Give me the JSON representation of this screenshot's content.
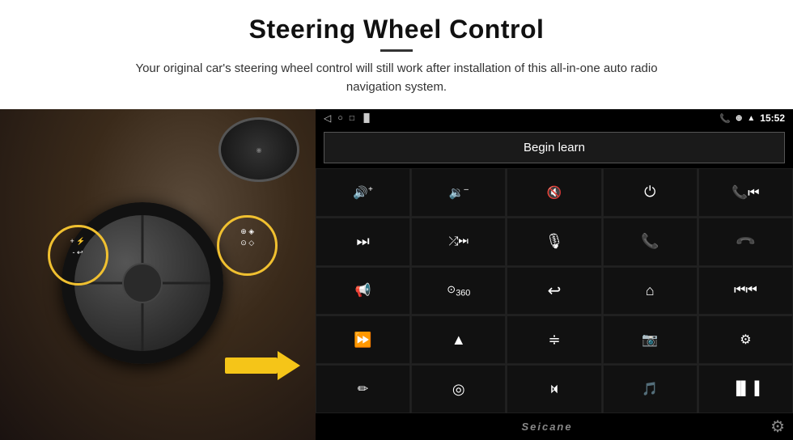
{
  "header": {
    "title": "Steering Wheel Control",
    "subtitle": "Your original car's steering wheel control will still work after installation of this all-in-one auto radio navigation system."
  },
  "status_bar": {
    "nav_back": "◁",
    "nav_home": "○",
    "nav_recent": "□",
    "signal_icon": "▐▌",
    "location_icon": "⊕",
    "wifi_icon": "▲",
    "time": "15:52",
    "phone_icon": "📞"
  },
  "begin_learn": {
    "label": "Begin learn"
  },
  "controls": [
    {
      "icon": "vol_up",
      "symbol": "🔊+",
      "unicode": ""
    },
    {
      "icon": "vol_down",
      "symbol": "🔉-",
      "unicode": ""
    },
    {
      "icon": "mute",
      "symbol": "🔇×",
      "unicode": ""
    },
    {
      "icon": "power",
      "symbol": "⏻",
      "unicode": ""
    },
    {
      "icon": "prev_track",
      "symbol": "⏮",
      "unicode": ""
    },
    {
      "icon": "next_track",
      "symbol": "⏭",
      "unicode": ""
    },
    {
      "icon": "shuffle",
      "symbol": "⤮⏭",
      "unicode": ""
    },
    {
      "icon": "mic",
      "symbol": "🎙",
      "unicode": ""
    },
    {
      "icon": "phone",
      "symbol": "📞",
      "unicode": ""
    },
    {
      "icon": "hang_up",
      "symbol": "📵",
      "unicode": ""
    },
    {
      "icon": "horn",
      "symbol": "📢",
      "unicode": ""
    },
    {
      "icon": "360_view",
      "symbol": "⊙360",
      "unicode": ""
    },
    {
      "icon": "undo",
      "symbol": "↩",
      "unicode": ""
    },
    {
      "icon": "home",
      "symbol": "⌂",
      "unicode": ""
    },
    {
      "icon": "skip_back",
      "symbol": "⏮⏮",
      "unicode": ""
    },
    {
      "icon": "fast_forward",
      "symbol": "⏩",
      "unicode": ""
    },
    {
      "icon": "navigate",
      "symbol": "▲",
      "unicode": ""
    },
    {
      "icon": "equalizer",
      "symbol": "≑",
      "unicode": ""
    },
    {
      "icon": "camera",
      "symbol": "📷",
      "unicode": ""
    },
    {
      "icon": "settings_sliders",
      "symbol": "⚙",
      "unicode": ""
    },
    {
      "icon": "pen",
      "symbol": "✏",
      "unicode": ""
    },
    {
      "icon": "compass",
      "symbol": "◎",
      "unicode": ""
    },
    {
      "icon": "bluetooth",
      "symbol": "⚡",
      "unicode": ""
    },
    {
      "icon": "music_note",
      "symbol": "♫",
      "unicode": ""
    },
    {
      "icon": "equalizer2",
      "symbol": "▐▌▐",
      "unicode": ""
    }
  ],
  "bottom_bar": {
    "brand": "Seicane",
    "gear_icon": "⚙"
  }
}
